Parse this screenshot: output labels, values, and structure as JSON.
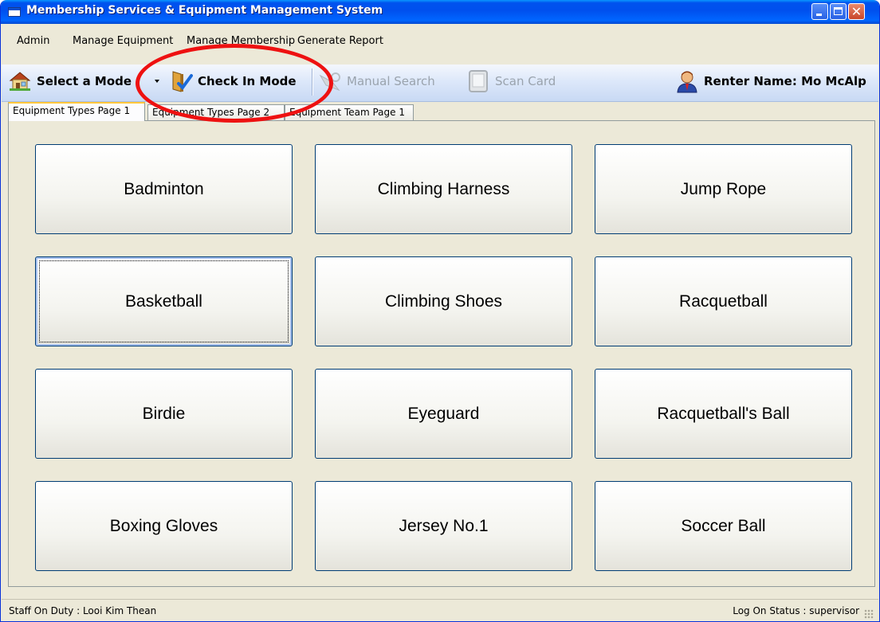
{
  "window": {
    "title": "Membership Services & Equipment Management System"
  },
  "menu": {
    "admin": "Admin",
    "manage_equipment": "Manage Equipment",
    "manage_membership": "Manage Membership",
    "generate_report": "Generate Report"
  },
  "toolbar": {
    "select_mode": "Select a Mode",
    "check_in_mode": "Check In Mode",
    "manual_search": "Manual Search",
    "scan_card": "Scan Card",
    "renter_name": "Renter Name: Mo McAlp"
  },
  "tabs": [
    "Equipment Types Page 1",
    "Equipment Types Page 2",
    "Equipment Team Page 1"
  ],
  "active_tab": "Equipment Types Page 1",
  "equipment": [
    "Badminton",
    "Climbing Harness",
    "Jump Rope",
    "Basketball",
    "Climbing Shoes",
    "Racquetball",
    "Birdie",
    "Eyeguard",
    "Racquetball's Ball",
    "Boxing Gloves",
    "Jersey No.1",
    "Soccer Ball"
  ],
  "status": {
    "staff_on_duty": "Staff On Duty :  Looi Kim Thean",
    "log_on_status": "Log On Status :  supervisor"
  },
  "colors": {
    "titlebar": "#0053ee",
    "annotation": "#ee1111",
    "button_border": "#003c74"
  }
}
